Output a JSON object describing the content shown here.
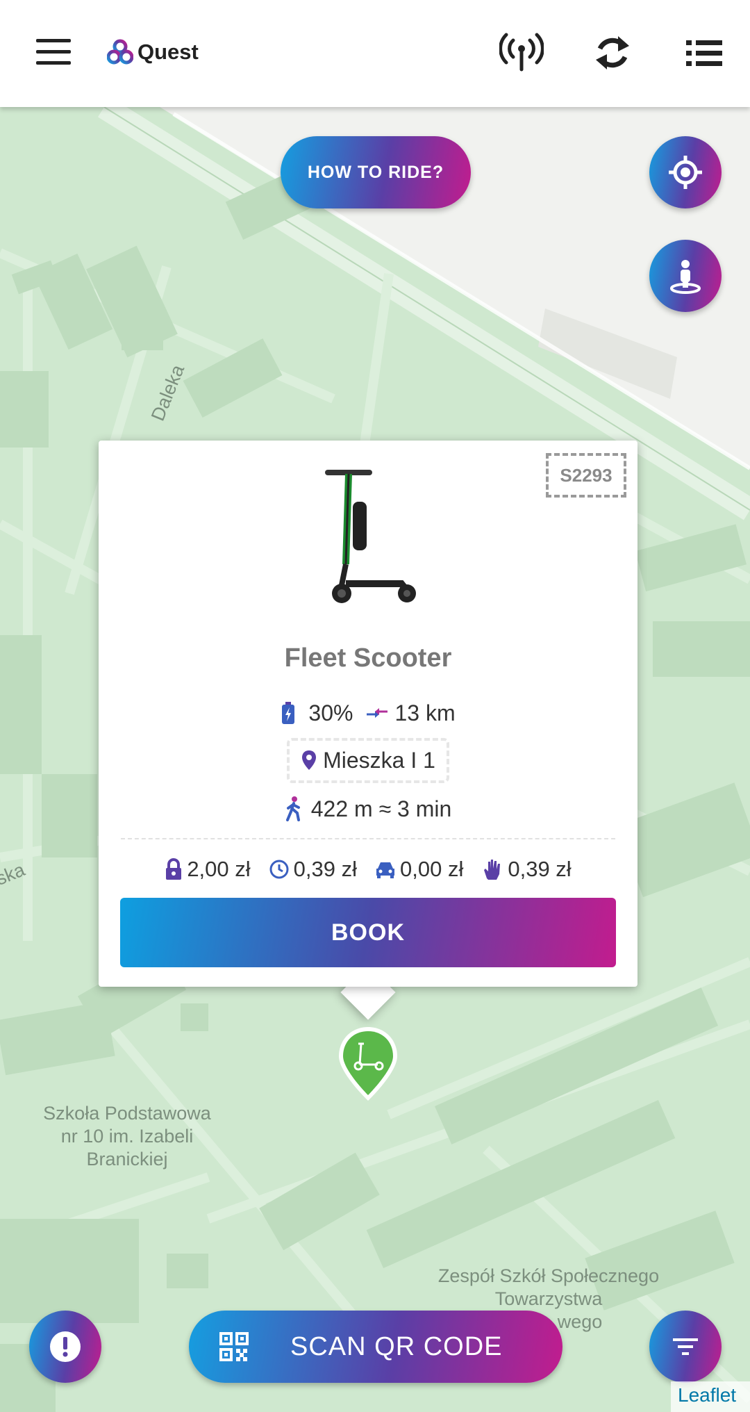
{
  "header": {
    "app_name": "Quest",
    "menu_icon": "hamburger-menu-icon",
    "antenna_icon": "antenna-icon",
    "refresh_icon": "refresh-icon",
    "list_icon": "list-icon"
  },
  "map": {
    "labels": {
      "street_daleka": "Daleka",
      "street_partial": "ska",
      "school": "Szkoła Podstawowa nr 10 im. Izabeli Branickiej",
      "school_lines": [
        "Szkoła Podstawowa",
        "nr 10 im. Izabeli",
        "Branickiej"
      ],
      "zespol_lines": [
        "Zespół Szkół Społecznego",
        "Towarzystwa",
        "wego"
      ]
    },
    "attribution": "Leaflet"
  },
  "controls": {
    "how_to_ride": "HOW TO RIDE?",
    "locate_icon": "crosshair-icon",
    "person_icon": "person-pin-icon",
    "alert_icon": "alert-icon",
    "filter_icon": "filter-icon",
    "scan_label": "SCAN QR CODE",
    "scan_icon": "qr-code-icon"
  },
  "popup": {
    "scooter_id": "S2293",
    "title": "Fleet Scooter",
    "battery": "30%",
    "range": "13 km",
    "location": "Mieszka I 1",
    "walk": "422 m ≈ 3 min",
    "prices": {
      "unlock": "2,00 zł",
      "per_minute": "0,39 zł",
      "parking": "0,00 zł",
      "pause": "0,39 zł"
    },
    "book_label": "BOOK"
  },
  "colors": {
    "gradient_start": "#159ee0",
    "gradient_mid": "#5a3fa6",
    "gradient_end": "#c21c8e",
    "marker_green": "#5bb84a",
    "map_green": "#cfe8cf",
    "icon_accent": "#5a3fa6"
  }
}
